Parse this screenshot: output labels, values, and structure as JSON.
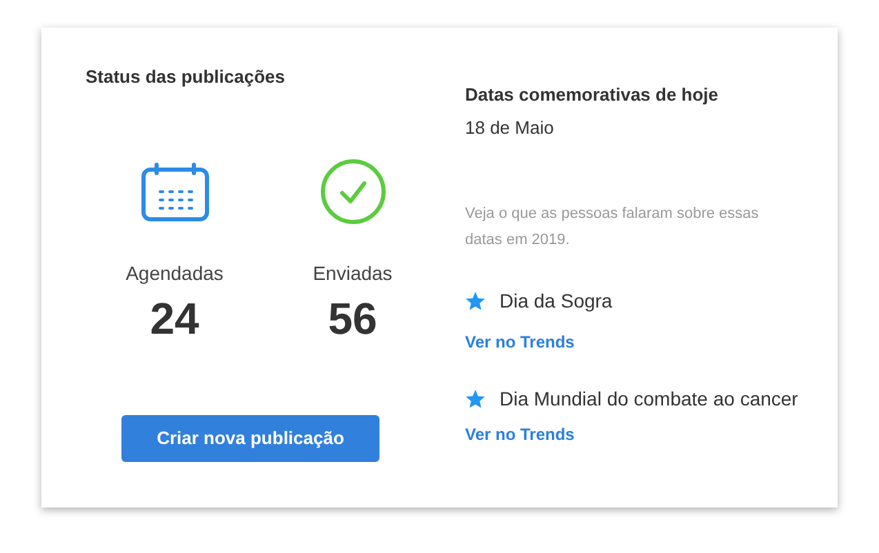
{
  "status": {
    "title": "Status das publicações",
    "stats": [
      {
        "kind": "calendar",
        "label": "Agendadas",
        "value": "24"
      },
      {
        "kind": "check",
        "label": "Enviadas",
        "value": "56"
      }
    ],
    "button": "Criar nova publicação"
  },
  "dates": {
    "title": "Datas comemorativas de hoje",
    "date": "18 de Maio",
    "description": "Veja o que as pessoas falaram sobre essas datas em 2019.",
    "events": [
      {
        "name": "Dia da Sogra",
        "link": "Ver no Trends"
      },
      {
        "name": "Dia Mundial do combate ao cancer",
        "link": "Ver no Trends"
      }
    ]
  }
}
